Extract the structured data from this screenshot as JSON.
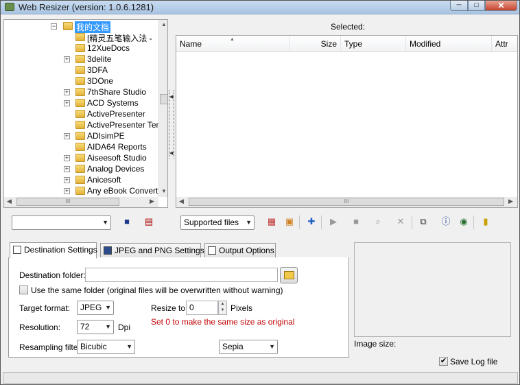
{
  "window": {
    "title": "Web Resizer (version: 1.0.6.1281)",
    "minimize": "─",
    "maximize": "□",
    "close": "✕"
  },
  "tree": {
    "root": "我的文档",
    "items": [
      {
        "label": "[精灵五笔输入法 -",
        "expander": false
      },
      {
        "label": "12XueDocs",
        "expander": false
      },
      {
        "label": "3delite",
        "expander": true
      },
      {
        "label": "3DFA",
        "expander": false
      },
      {
        "label": "3DOne",
        "expander": false
      },
      {
        "label": "7thShare Studio",
        "expander": true
      },
      {
        "label": "ACD Systems",
        "expander": true
      },
      {
        "label": "ActivePresenter",
        "expander": false
      },
      {
        "label": "ActivePresenter Tem",
        "expander": false
      },
      {
        "label": "ADIsimPE",
        "expander": true
      },
      {
        "label": "AIDA64 Reports",
        "expander": false
      },
      {
        "label": "Aiseesoft Studio",
        "expander": true
      },
      {
        "label": "Analog Devices",
        "expander": true
      },
      {
        "label": "Anicesoft",
        "expander": true
      },
      {
        "label": "Any eBook Converter",
        "expander": true
      }
    ],
    "hscroll_grip": "III"
  },
  "list": {
    "selected_label": "Selected:",
    "columns": [
      "Name",
      "Size",
      "Type",
      "Modified",
      "Attr"
    ],
    "hscroll_grip": "III"
  },
  "toolbar": {
    "preset_value": "",
    "filter_value": "Supported files"
  },
  "tabs": {
    "destination": "Destination Settings",
    "jpeg_png": "JPEG and PNG Settings",
    "output": "Output Options"
  },
  "settings": {
    "destination_folder_label": "Destination folder:",
    "destination_folder_value": "",
    "same_folder_label": "Use the same folder (original files will be overwritten without warning)",
    "same_folder_checked": false,
    "target_format_label": "Target format:",
    "target_format_value": "JPEG",
    "resize_to_label": "Resize to:",
    "resize_to_value": "0",
    "pixels_label": "Pixels",
    "note": "Set 0 to make the same size as original",
    "resolution_label": "Resolution:",
    "resolution_value": "72",
    "dpi_label": "Dpi",
    "resampling_label": "Resampling filter:",
    "resampling_value": "Bicubic",
    "effect_value": "Sepia"
  },
  "preview": {
    "image_size_label": "Image size:",
    "save_log_label": "Save Log file",
    "save_log_checked": true
  }
}
